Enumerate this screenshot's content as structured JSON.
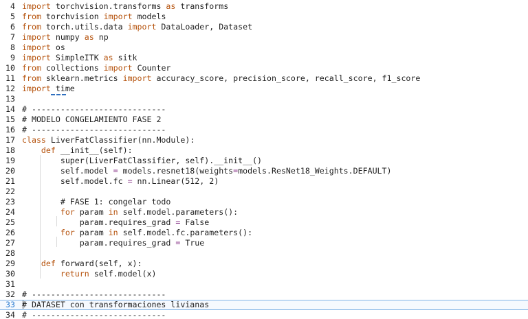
{
  "editor": {
    "lines": [
      {
        "n": "4",
        "tokens": [
          [
            "kw",
            "import"
          ],
          [
            "t",
            " torchvision.transforms "
          ],
          [
            "kw",
            "as"
          ],
          [
            "t",
            " transforms"
          ]
        ]
      },
      {
        "n": "5",
        "tokens": [
          [
            "kw",
            "from"
          ],
          [
            "t",
            " torchvision "
          ],
          [
            "kw",
            "import"
          ],
          [
            "t",
            " models"
          ]
        ]
      },
      {
        "n": "6",
        "tokens": [
          [
            "kw",
            "from"
          ],
          [
            "t",
            " torch.utils.data "
          ],
          [
            "kw",
            "import"
          ],
          [
            "t",
            " DataLoader, Dataset"
          ]
        ]
      },
      {
        "n": "7",
        "tokens": [
          [
            "kw",
            "import"
          ],
          [
            "t",
            " numpy "
          ],
          [
            "kw",
            "as"
          ],
          [
            "t",
            " np"
          ]
        ]
      },
      {
        "n": "8",
        "tokens": [
          [
            "kw",
            "import"
          ],
          [
            "t",
            " os"
          ]
        ]
      },
      {
        "n": "9",
        "tokens": [
          [
            "kw",
            "import"
          ],
          [
            "t",
            " SimpleITK "
          ],
          [
            "kw",
            "as"
          ],
          [
            "t",
            " sitk"
          ]
        ]
      },
      {
        "n": "10",
        "tokens": [
          [
            "kw",
            "from"
          ],
          [
            "t",
            " collections "
          ],
          [
            "kw",
            "import"
          ],
          [
            "t",
            " Counter"
          ]
        ]
      },
      {
        "n": "11",
        "tokens": [
          [
            "kw",
            "from"
          ],
          [
            "t",
            " sklearn.metrics "
          ],
          [
            "kw",
            "import"
          ],
          [
            "t",
            " accuracy_score, precision_score, recall_score, f1_score"
          ]
        ]
      },
      {
        "n": "12",
        "tokens": [
          [
            "kw",
            "import"
          ],
          [
            "t",
            " time"
          ]
        ]
      },
      {
        "n": "13",
        "tokens": []
      },
      {
        "n": "14",
        "tokens": [
          [
            "cm",
            "# ----------------------------"
          ]
        ]
      },
      {
        "n": "15",
        "tokens": [
          [
            "cm",
            "# MODELO CONGELAMIENTO FASE 2"
          ]
        ]
      },
      {
        "n": "16",
        "tokens": [
          [
            "cm",
            "# ----------------------------"
          ]
        ]
      },
      {
        "n": "17",
        "tokens": [
          [
            "kw",
            "class"
          ],
          [
            "t",
            " LiverFatClassifier(nn.Module):"
          ]
        ]
      },
      {
        "n": "18",
        "tokens": [
          [
            "t",
            "    "
          ],
          [
            "kw",
            "def"
          ],
          [
            "t",
            " __init__(self):"
          ]
        ]
      },
      {
        "n": "19",
        "tokens": [
          [
            "t",
            "        super(LiverFatClassifier, self).__init__()"
          ]
        ]
      },
      {
        "n": "20",
        "tokens": [
          [
            "t",
            "        self.model "
          ],
          [
            "op",
            "="
          ],
          [
            "t",
            " models.resnet18(weights"
          ],
          [
            "op",
            "="
          ],
          [
            "t",
            "models.ResNet18_Weights.DEFAULT)"
          ]
        ]
      },
      {
        "n": "21",
        "tokens": [
          [
            "t",
            "        self.model.fc "
          ],
          [
            "op",
            "="
          ],
          [
            "t",
            " nn.Linear(512, 2)"
          ]
        ]
      },
      {
        "n": "22",
        "tokens": []
      },
      {
        "n": "23",
        "tokens": [
          [
            "t",
            "        "
          ],
          [
            "cm",
            "# FASE 1: congelar todo"
          ]
        ]
      },
      {
        "n": "24",
        "tokens": [
          [
            "t",
            "        "
          ],
          [
            "kw",
            "for"
          ],
          [
            "t",
            " param "
          ],
          [
            "kw",
            "in"
          ],
          [
            "t",
            " self.model.parameters():"
          ]
        ]
      },
      {
        "n": "25",
        "tokens": [
          [
            "t",
            "            param.requires_grad "
          ],
          [
            "op",
            "="
          ],
          [
            "t",
            " False"
          ]
        ]
      },
      {
        "n": "26",
        "tokens": [
          [
            "t",
            "        "
          ],
          [
            "kw",
            "for"
          ],
          [
            "t",
            " param "
          ],
          [
            "kw",
            "in"
          ],
          [
            "t",
            " self.model.fc.parameters():"
          ]
        ]
      },
      {
        "n": "27",
        "tokens": [
          [
            "t",
            "            param.requires_grad "
          ],
          [
            "op",
            "="
          ],
          [
            "t",
            " True"
          ]
        ]
      },
      {
        "n": "28",
        "tokens": []
      },
      {
        "n": "29",
        "tokens": [
          [
            "t",
            "    "
          ],
          [
            "kw",
            "def"
          ],
          [
            "t",
            " forward(self, x):"
          ]
        ]
      },
      {
        "n": "30",
        "tokens": [
          [
            "t",
            "        "
          ],
          [
            "kw",
            "return"
          ],
          [
            "t",
            " self.model(x)"
          ]
        ]
      },
      {
        "n": "31",
        "tokens": []
      },
      {
        "n": "32",
        "tokens": [
          [
            "cm",
            "# ----------------------------"
          ]
        ]
      },
      {
        "n": "33",
        "tokens": [
          [
            "cm",
            "# DATASET con transformaciones livianas"
          ]
        ]
      },
      {
        "n": "34",
        "tokens": [
          [
            "cm",
            "# ----------------------------"
          ]
        ]
      }
    ],
    "active_line": "33",
    "colors": {
      "keyword": "#b5520c",
      "text": "#1f1f1f",
      "operator": "#8b3a8b",
      "active_line_border": "#7fb3e6",
      "squiggle": "#2f6fbf"
    }
  }
}
